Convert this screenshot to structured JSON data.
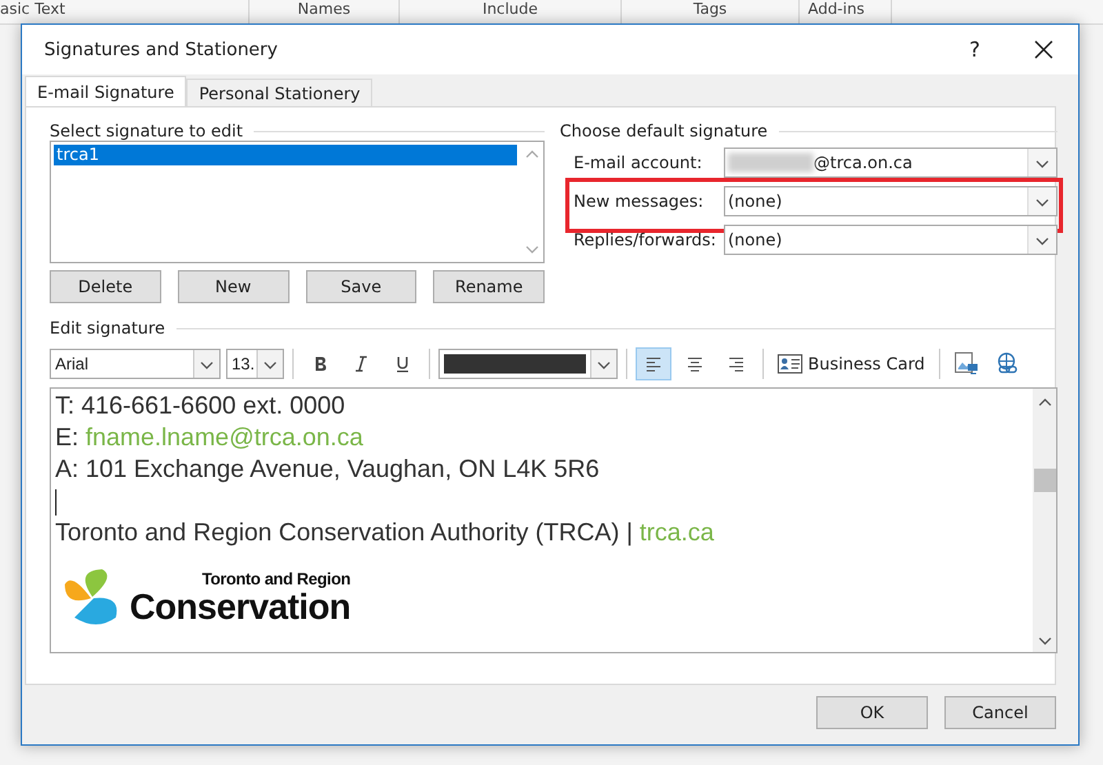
{
  "background_ribbon": {
    "groups": [
      "asic Text",
      "Names",
      "Include",
      "Tags",
      "Add-ins"
    ]
  },
  "window": {
    "title": "Signatures and Stationery",
    "help": "?"
  },
  "tabs": [
    {
      "label": "E-mail Signature",
      "selected": true
    },
    {
      "label": "Personal Stationery",
      "selected": false
    }
  ],
  "select_signature": {
    "heading": "Select signature to edit",
    "items": [
      {
        "label": "trca1",
        "selected": true
      }
    ],
    "buttons": [
      "Delete",
      "New",
      "Save",
      "Rename"
    ]
  },
  "default_signature": {
    "heading": "Choose default signature",
    "fields": [
      {
        "label": "E-mail account:",
        "value": "@trca.on.ca",
        "redacted": true,
        "highlighted": false
      },
      {
        "label": "New messages:",
        "value": "(none)",
        "redacted": false,
        "highlighted": true
      },
      {
        "label": "Replies/forwards:",
        "value": "(none)",
        "redacted": false,
        "highlighted": false
      }
    ]
  },
  "edit_signature": {
    "heading": "Edit signature",
    "font": "Arial",
    "size": "13.",
    "alignment": [
      {
        "kind": "left",
        "selected": true
      },
      {
        "kind": "center",
        "selected": false
      },
      {
        "kind": "right",
        "selected": false
      }
    ],
    "business_card": "Business Card",
    "lines": [
      {
        "text": "T: 416-661-6600 ext. 0000"
      },
      {
        "text": "E: ",
        "link": "fname.lname@trca.on.ca"
      },
      {
        "text": "A: 101 Exchange Avenue, Vaughan, ON L4K 5R6"
      },
      {
        "cursor": true
      },
      {
        "text": "Toronto and Region Conservation Authority (TRCA) | ",
        "link": "trca.ca"
      }
    ],
    "logo": {
      "small": "Toronto and Region",
      "large": "Conservation"
    }
  },
  "buttons": [
    "OK",
    "Cancel"
  ]
}
